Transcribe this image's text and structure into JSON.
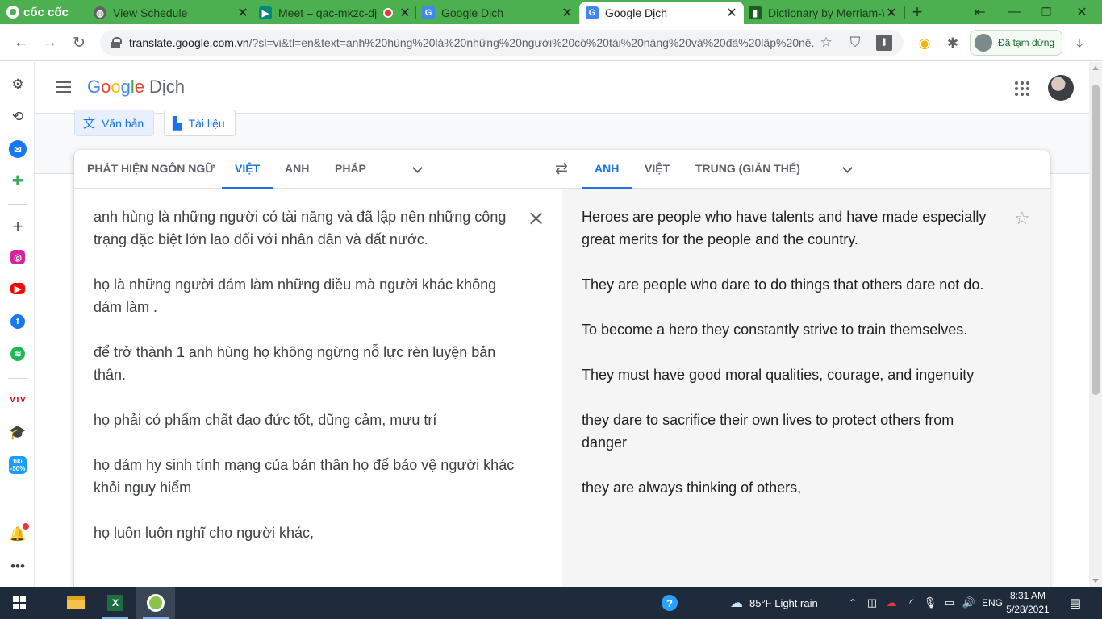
{
  "browser": {
    "brand": "cốc cốc",
    "tabs": [
      {
        "title": "View Schedule",
        "icon": "globe-icon",
        "active": false
      },
      {
        "title": "Meet – qac-mkzc-dj",
        "icon": "meet-icon",
        "active": false,
        "recording": true
      },
      {
        "title": "Google Dịch",
        "icon": "google-translate-icon",
        "active": false
      },
      {
        "title": "Google Dịch",
        "icon": "google-translate-icon",
        "active": true
      },
      {
        "title": "Dictionary by Merriam-W",
        "icon": "merriam-webster-icon",
        "active": false
      }
    ],
    "new_tab": "+",
    "url_host": "translate.google.com.vn",
    "url_rest": "/?sl=vi&tl=en&text=anh%20hùng%20là%20những%20người%20có%20tài%20năng%20và%20đã%20lập%20nê...",
    "profile_status": "Đã tạm dừng"
  },
  "app": {
    "logo_letters": [
      "G",
      "o",
      "o",
      "g",
      "l",
      "e"
    ],
    "logo_colors": [
      "#4285f4",
      "#ea4335",
      "#fbbc04",
      "#4285f4",
      "#34a853",
      "#ea4335"
    ],
    "product": "Dịch",
    "modes": {
      "text": "Văn bản",
      "documents": "Tài liệu"
    },
    "source_langs": [
      "PHÁT HIỆN NGÔN NGỮ",
      "VIỆT",
      "ANH",
      "PHÁP"
    ],
    "source_active": "VIỆT",
    "target_langs": [
      "ANH",
      "VIỆT",
      "TRUNG (GIẢN THỂ)"
    ],
    "target_active": "ANH",
    "source_paragraphs": [
      "anh hùng là những người có tài năng và đã lập nên những công trạng đặc biệt lớn lao đối với nhân dân và đất nước.",
      "họ là những người dám làm những điều mà người khác không dám làm .",
      "để trở thành 1 anh hùng họ không ngừng nỗ lực rèn luyện bản thân.",
      "họ phải có phẩm chất đạo đức tốt, dũng cảm, mưu trí",
      "họ dám hy sinh tính mạng của bản thân họ để bảo vệ người khác khỏi nguy hiểm",
      "họ luôn luôn nghĩ cho người khác,"
    ],
    "target_paragraphs": [
      "Heroes are people who have talents and have made especially great merits for the people and the country.",
      "They are people who dare to do things that others dare not do.",
      "To become a hero they constantly strive to train themselves.",
      "They must have good moral qualities, courage, and ingenuity",
      "they dare to sacrifice their own lives to protect others from danger",
      "they are always thinking of others,"
    ],
    "accent_color": "#1a73e8"
  },
  "taskbar": {
    "weather": "85°F  Light rain",
    "language": "ENG",
    "time": "8:31 AM",
    "date": "5/28/2021"
  }
}
